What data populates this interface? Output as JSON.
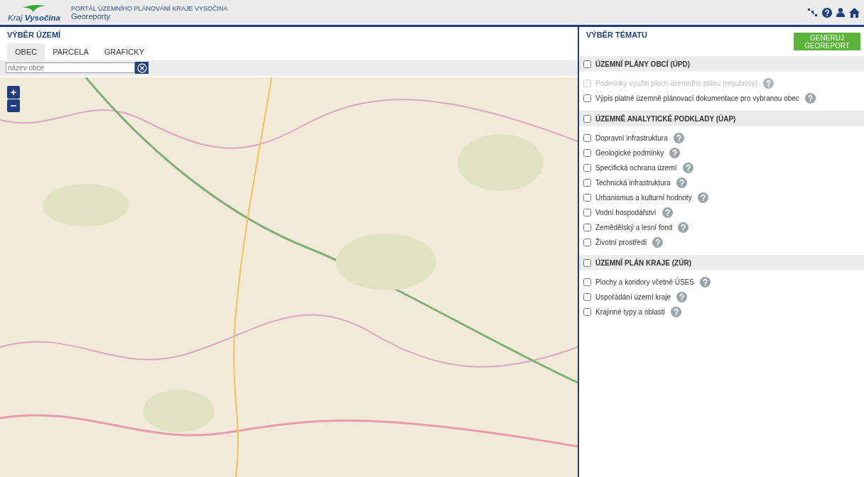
{
  "header": {
    "logo": {
      "prefix": "Kraj",
      "name": "Vysočina"
    },
    "portal_title": "PORTÁL ÚZEMNÍHO PLÁNOVÁNÍ KRAJE VYSOČINA",
    "subtitle": "Georeporty"
  },
  "area_panel": {
    "title": "VÝBĚR ÚZEMÍ",
    "tabs": [
      {
        "label": "OBEC",
        "selected": true
      },
      {
        "label": "PARCELA",
        "selected": false
      },
      {
        "label": "GRAFICKY",
        "selected": false
      }
    ],
    "search": {
      "placeholder": "název obce"
    },
    "map": {
      "zoom_in": "+",
      "zoom_out": "−"
    }
  },
  "theme_panel": {
    "title": "VÝBĚR TÉMATU",
    "button": "GENERUJ GEOREPORT",
    "sections": [
      {
        "title": "ÚZEMNÍ PLÁNY OBCÍ (ÚPD)",
        "checked": false,
        "items": [
          {
            "label": "Podmínky využití ploch územního plánu (regulativy)",
            "checked": false,
            "disabled": true
          },
          {
            "label": "Výpis platné územně plánovací dokumentace pro vybranou obec",
            "checked": false,
            "disabled": false
          }
        ]
      },
      {
        "title": "ÚZEMNĚ ANALYTICKÉ PODKLADY (ÚAP)",
        "checked": false,
        "items": [
          {
            "label": "Dopravní infrastruktura",
            "checked": false,
            "disabled": false
          },
          {
            "label": "Geologické podmínky",
            "checked": false,
            "disabled": false
          },
          {
            "label": "Specifická ochrana území",
            "checked": false,
            "disabled": false
          },
          {
            "label": "Technická infrastruktura",
            "checked": false,
            "disabled": false
          },
          {
            "label": "Urbanismus a kulturní hodnoty",
            "checked": false,
            "disabled": false
          },
          {
            "label": "Vodní hospodářství",
            "checked": false,
            "disabled": false
          },
          {
            "label": "Zemědělský a lesní fond",
            "checked": false,
            "disabled": false
          },
          {
            "label": "Životní prostředí",
            "checked": false,
            "disabled": false
          }
        ]
      },
      {
        "title": "ÚZEMNÍ PLÁN KRAJE (ZÚR)",
        "checked": false,
        "items": [
          {
            "label": "Plochy a koridory včetně ÚSES",
            "checked": false,
            "disabled": false
          },
          {
            "label": "Uspořádání území kraje",
            "checked": false,
            "disabled": false
          },
          {
            "label": "Krajinné typy a oblasti",
            "checked": false,
            "disabled": false
          }
        ]
      }
    ]
  }
}
